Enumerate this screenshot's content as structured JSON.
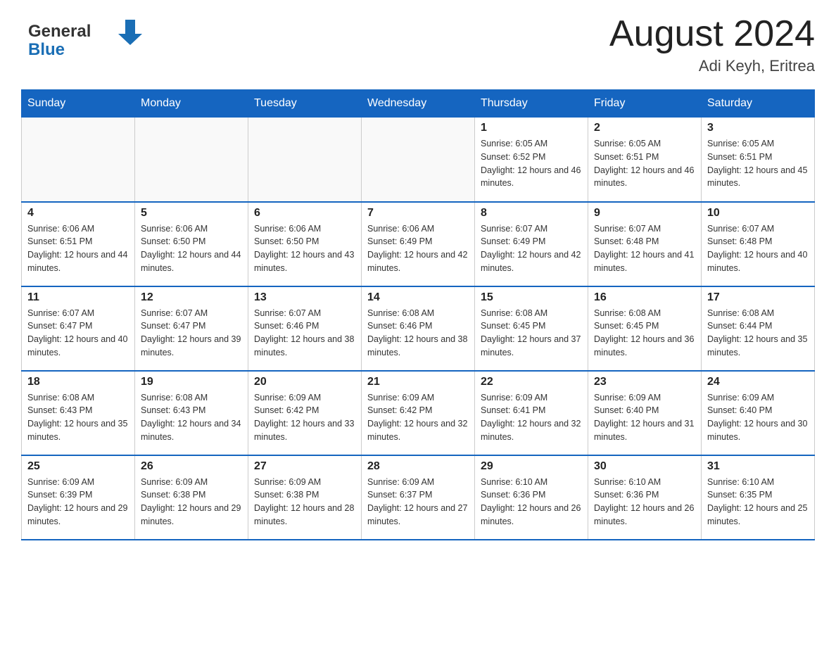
{
  "header": {
    "title": "August 2024",
    "location": "Adi Keyh, Eritrea",
    "logo_general": "General",
    "logo_blue": "Blue"
  },
  "days_of_week": [
    "Sunday",
    "Monday",
    "Tuesday",
    "Wednesday",
    "Thursday",
    "Friday",
    "Saturday"
  ],
  "weeks": [
    [
      {
        "day": "",
        "sunrise": "",
        "sunset": "",
        "daylight": ""
      },
      {
        "day": "",
        "sunrise": "",
        "sunset": "",
        "daylight": ""
      },
      {
        "day": "",
        "sunrise": "",
        "sunset": "",
        "daylight": ""
      },
      {
        "day": "",
        "sunrise": "",
        "sunset": "",
        "daylight": ""
      },
      {
        "day": "1",
        "sunrise": "Sunrise: 6:05 AM",
        "sunset": "Sunset: 6:52 PM",
        "daylight": "Daylight: 12 hours and 46 minutes."
      },
      {
        "day": "2",
        "sunrise": "Sunrise: 6:05 AM",
        "sunset": "Sunset: 6:51 PM",
        "daylight": "Daylight: 12 hours and 46 minutes."
      },
      {
        "day": "3",
        "sunrise": "Sunrise: 6:05 AM",
        "sunset": "Sunset: 6:51 PM",
        "daylight": "Daylight: 12 hours and 45 minutes."
      }
    ],
    [
      {
        "day": "4",
        "sunrise": "Sunrise: 6:06 AM",
        "sunset": "Sunset: 6:51 PM",
        "daylight": "Daylight: 12 hours and 44 minutes."
      },
      {
        "day": "5",
        "sunrise": "Sunrise: 6:06 AM",
        "sunset": "Sunset: 6:50 PM",
        "daylight": "Daylight: 12 hours and 44 minutes."
      },
      {
        "day": "6",
        "sunrise": "Sunrise: 6:06 AM",
        "sunset": "Sunset: 6:50 PM",
        "daylight": "Daylight: 12 hours and 43 minutes."
      },
      {
        "day": "7",
        "sunrise": "Sunrise: 6:06 AM",
        "sunset": "Sunset: 6:49 PM",
        "daylight": "Daylight: 12 hours and 42 minutes."
      },
      {
        "day": "8",
        "sunrise": "Sunrise: 6:07 AM",
        "sunset": "Sunset: 6:49 PM",
        "daylight": "Daylight: 12 hours and 42 minutes."
      },
      {
        "day": "9",
        "sunrise": "Sunrise: 6:07 AM",
        "sunset": "Sunset: 6:48 PM",
        "daylight": "Daylight: 12 hours and 41 minutes."
      },
      {
        "day": "10",
        "sunrise": "Sunrise: 6:07 AM",
        "sunset": "Sunset: 6:48 PM",
        "daylight": "Daylight: 12 hours and 40 minutes."
      }
    ],
    [
      {
        "day": "11",
        "sunrise": "Sunrise: 6:07 AM",
        "sunset": "Sunset: 6:47 PM",
        "daylight": "Daylight: 12 hours and 40 minutes."
      },
      {
        "day": "12",
        "sunrise": "Sunrise: 6:07 AM",
        "sunset": "Sunset: 6:47 PM",
        "daylight": "Daylight: 12 hours and 39 minutes."
      },
      {
        "day": "13",
        "sunrise": "Sunrise: 6:07 AM",
        "sunset": "Sunset: 6:46 PM",
        "daylight": "Daylight: 12 hours and 38 minutes."
      },
      {
        "day": "14",
        "sunrise": "Sunrise: 6:08 AM",
        "sunset": "Sunset: 6:46 PM",
        "daylight": "Daylight: 12 hours and 38 minutes."
      },
      {
        "day": "15",
        "sunrise": "Sunrise: 6:08 AM",
        "sunset": "Sunset: 6:45 PM",
        "daylight": "Daylight: 12 hours and 37 minutes."
      },
      {
        "day": "16",
        "sunrise": "Sunrise: 6:08 AM",
        "sunset": "Sunset: 6:45 PM",
        "daylight": "Daylight: 12 hours and 36 minutes."
      },
      {
        "day": "17",
        "sunrise": "Sunrise: 6:08 AM",
        "sunset": "Sunset: 6:44 PM",
        "daylight": "Daylight: 12 hours and 35 minutes."
      }
    ],
    [
      {
        "day": "18",
        "sunrise": "Sunrise: 6:08 AM",
        "sunset": "Sunset: 6:43 PM",
        "daylight": "Daylight: 12 hours and 35 minutes."
      },
      {
        "day": "19",
        "sunrise": "Sunrise: 6:08 AM",
        "sunset": "Sunset: 6:43 PM",
        "daylight": "Daylight: 12 hours and 34 minutes."
      },
      {
        "day": "20",
        "sunrise": "Sunrise: 6:09 AM",
        "sunset": "Sunset: 6:42 PM",
        "daylight": "Daylight: 12 hours and 33 minutes."
      },
      {
        "day": "21",
        "sunrise": "Sunrise: 6:09 AM",
        "sunset": "Sunset: 6:42 PM",
        "daylight": "Daylight: 12 hours and 32 minutes."
      },
      {
        "day": "22",
        "sunrise": "Sunrise: 6:09 AM",
        "sunset": "Sunset: 6:41 PM",
        "daylight": "Daylight: 12 hours and 32 minutes."
      },
      {
        "day": "23",
        "sunrise": "Sunrise: 6:09 AM",
        "sunset": "Sunset: 6:40 PM",
        "daylight": "Daylight: 12 hours and 31 minutes."
      },
      {
        "day": "24",
        "sunrise": "Sunrise: 6:09 AM",
        "sunset": "Sunset: 6:40 PM",
        "daylight": "Daylight: 12 hours and 30 minutes."
      }
    ],
    [
      {
        "day": "25",
        "sunrise": "Sunrise: 6:09 AM",
        "sunset": "Sunset: 6:39 PM",
        "daylight": "Daylight: 12 hours and 29 minutes."
      },
      {
        "day": "26",
        "sunrise": "Sunrise: 6:09 AM",
        "sunset": "Sunset: 6:38 PM",
        "daylight": "Daylight: 12 hours and 29 minutes."
      },
      {
        "day": "27",
        "sunrise": "Sunrise: 6:09 AM",
        "sunset": "Sunset: 6:38 PM",
        "daylight": "Daylight: 12 hours and 28 minutes."
      },
      {
        "day": "28",
        "sunrise": "Sunrise: 6:09 AM",
        "sunset": "Sunset: 6:37 PM",
        "daylight": "Daylight: 12 hours and 27 minutes."
      },
      {
        "day": "29",
        "sunrise": "Sunrise: 6:10 AM",
        "sunset": "Sunset: 6:36 PM",
        "daylight": "Daylight: 12 hours and 26 minutes."
      },
      {
        "day": "30",
        "sunrise": "Sunrise: 6:10 AM",
        "sunset": "Sunset: 6:36 PM",
        "daylight": "Daylight: 12 hours and 26 minutes."
      },
      {
        "day": "31",
        "sunrise": "Sunrise: 6:10 AM",
        "sunset": "Sunset: 6:35 PM",
        "daylight": "Daylight: 12 hours and 25 minutes."
      }
    ]
  ]
}
